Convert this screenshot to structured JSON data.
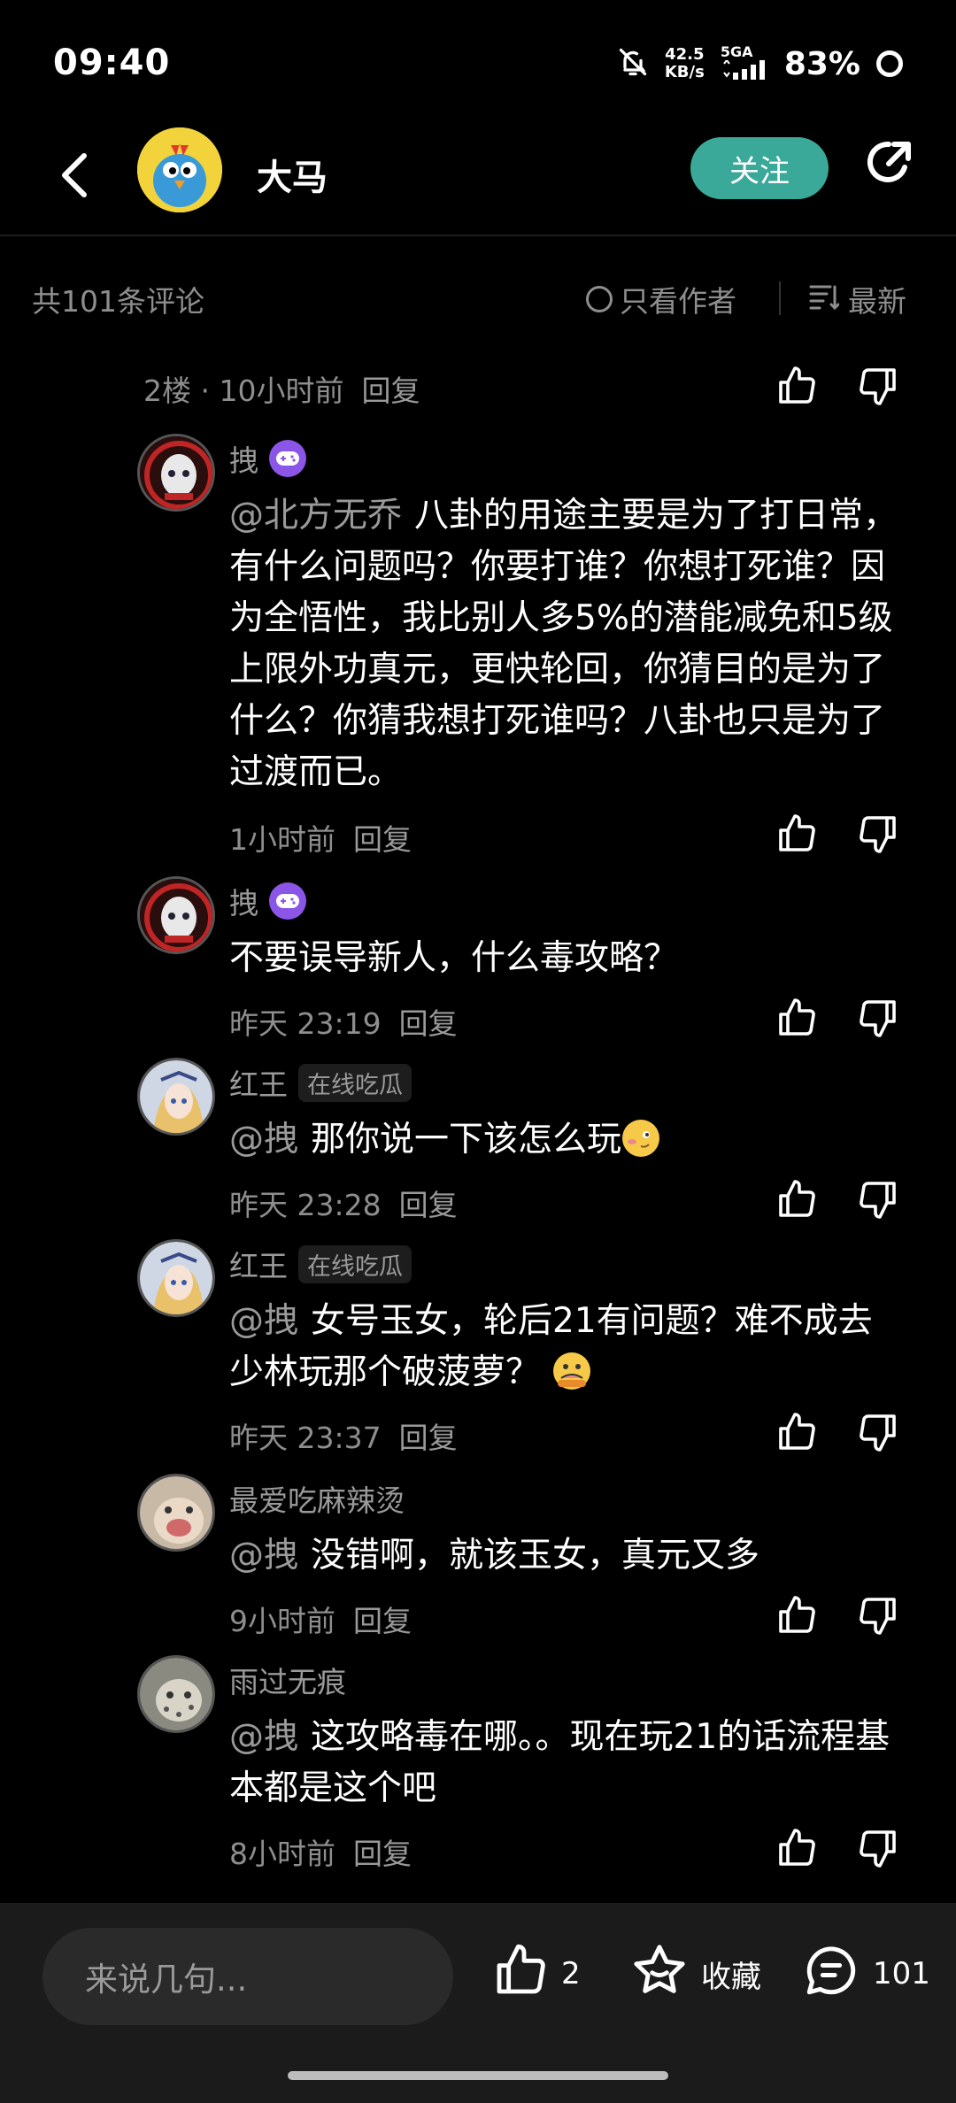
{
  "status_bar": {
    "time": "09:40",
    "net_speed_top": "42.5",
    "net_speed_unit": "KB/s",
    "network": "5GA",
    "battery": "83%"
  },
  "header": {
    "author_name": "大马",
    "follow_label": "关注"
  },
  "sort_bar": {
    "total": "共101条评论",
    "only_author": "只看作者",
    "latest": "最新"
  },
  "floor": {
    "label": "2楼 · 10小时前",
    "reply": "回复"
  },
  "comments": [
    {
      "name": "拽",
      "mention": "@北方无乔",
      "text": "八卦的用途主要是为了打日常，有什么问题吗？你要打谁？你想打死谁？因为全悟性，我比别人多5%的潜能减免和5级上限外功真元，更快轮回，你猜目的是为了什么？你猜我想打死谁吗？八卦也只是为了过渡而已。",
      "time": "1小时前",
      "reply": "回复"
    },
    {
      "name": "拽",
      "mention": "",
      "text": "不要误导新人，什么毒攻略？",
      "time": "昨天 23:19",
      "reply": "回复"
    },
    {
      "name": "红王",
      "tag": "在线吃瓜",
      "mention": "@拽",
      "text": "那你说一下该怎么玩",
      "time": "昨天 23:28",
      "reply": "回复"
    },
    {
      "name": "红王",
      "tag": "在线吃瓜",
      "mention": "@拽",
      "text": "女号玉女，轮后21有问题？难不成去少林玩那个破菠萝？",
      "time": "昨天 23:37",
      "reply": "回复"
    },
    {
      "name": "最爱吃麻辣烫",
      "mention": "@拽",
      "text": "没错啊，就该玉女，真元又多",
      "time": "9小时前",
      "reply": "回复"
    },
    {
      "name": "雨过无痕",
      "mention": "@拽",
      "text": "这攻略毒在哪。。现在玩21的话流程基本都是这个吧",
      "time": "8小时前",
      "reply": "回复"
    }
  ],
  "bottom_bar": {
    "input_placeholder": "来说几句...",
    "like_count": "2",
    "favorite_label": "收藏",
    "comment_count": "101"
  },
  "colors": {
    "background": "#000000",
    "accent": "#3aa99a",
    "secondary_text": "#8e8e8e",
    "badge": "#8b55e8"
  },
  "icons": [
    "back-arrow-icon",
    "share-icon",
    "thumb-up-icon",
    "thumb-down-icon",
    "sort-icon",
    "star-icon",
    "comment-icon",
    "gamepad-icon",
    "mute-icon",
    "signal-icon"
  ]
}
